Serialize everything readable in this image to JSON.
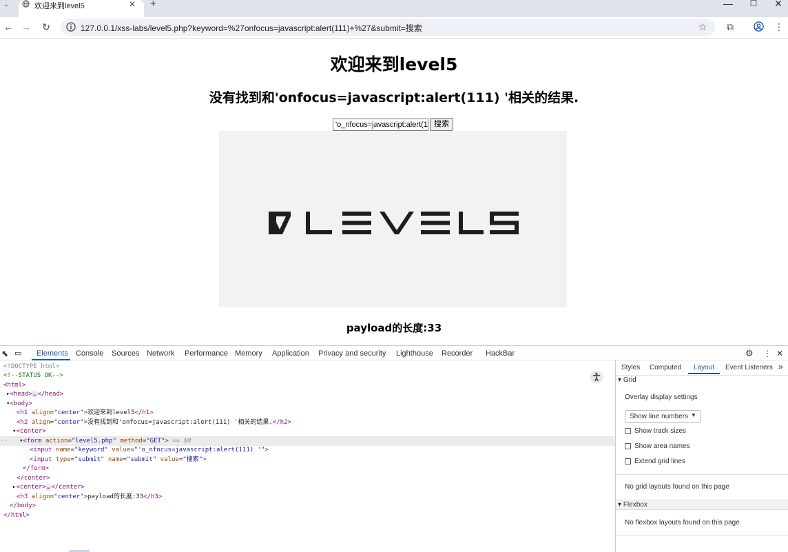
{
  "browser": {
    "tab_title": "欢迎来到level5",
    "url": "127.0.0.1/xss-labs/level5.php?keyword=%27onfocus=javascript:alert(111)+%27&submit=搜索"
  },
  "page": {
    "h1": "欢迎来到level5",
    "h2": "没有找到和'onfocus=javascript:alert(111) '相关的结果.",
    "input_value": "'o_nfocus=javascript:alert(11",
    "submit_label": "搜索",
    "logo_text": "LEVEL5",
    "h3": "payload的长度:33"
  },
  "devtools": {
    "tabs": [
      "Elements",
      "Console",
      "Sources",
      "Network",
      "Performance",
      "Memory",
      "Application",
      "Privacy and security",
      "Lighthouse",
      "Recorder",
      "HackBar"
    ],
    "active_tab": "Elements",
    "dom": {
      "l0": "<!DOCTYPE html>",
      "l1": "<!--STATUS OK-->",
      "html_open": "<html>",
      "head": "<head>",
      "ellipsis": "…",
      "head_close": "</head>",
      "body_open": "<body>",
      "h1_open": "<h1",
      "align_attr": "align",
      "center_val": "\"center\"",
      "h1_text": "欢迎来到level5",
      "h1_close": "</h1>",
      "h2_open": "<h2",
      "h2_text": "没有找到和'onfocus=javascript:alert(111) '相关的结果.",
      "h2_close": "</h2>",
      "center_open": "<center>",
      "form_open": "<form",
      "action_attr": "action",
      "action_val": "\"level5.php\"",
      "method_attr": "method",
      "method_val": "\"GET\"",
      "form_end": ">",
      "dollar": "== $0",
      "input_open": "<input",
      "name_attr": "name",
      "keyword_val": "\"keyword\"",
      "value_attr": "value",
      "input1_val": "\"'o_nfocus=javascript:alert(111) '\"",
      "input_close": ">",
      "type_attr": "type",
      "submit_val": "\"submit\"",
      "submit_name_val": "\"submit\"",
      "search_val": "\"搜索\"",
      "form_close": "</form>",
      "center_close": "</center>",
      "center2_open": "<center>",
      "center2_close": "</center>",
      "h3_open": "<h3",
      "h3_text": "payload的长度:33",
      "h3_close": "</h3>",
      "body_close": "</body>",
      "html_close": "</html>"
    },
    "side_tabs": [
      "Styles",
      "Computed",
      "Layout",
      "Event Listeners"
    ],
    "side_active": "Layout",
    "grid_header": "Grid",
    "overlay_label": "Overlay display settings",
    "select_value": "Show line numbers",
    "checkboxes": [
      "Show track sizes",
      "Show area names",
      "Extend grid lines"
    ],
    "no_grid": "No grid layouts found on this page",
    "flex_header": "Flexbox",
    "no_flex": "No flexbox layouts found on this page"
  }
}
